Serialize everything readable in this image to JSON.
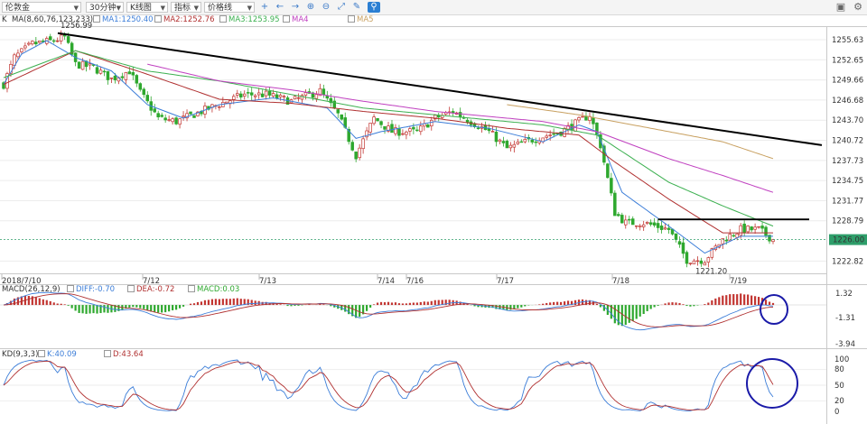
{
  "toolbar": {
    "instrument": "伦敦金",
    "period": "30分钟",
    "chart_type": "K线图",
    "indicator": "指标",
    "price_line": "价格线"
  },
  "legend_main": {
    "prefix": "K",
    "ma_params": "MA(8,60,76,123,233)",
    "ma1": "MA1:1250.40",
    "ma2": "MA2:1252.76",
    "ma3": "MA3:1253.95",
    "ma4": "MA4",
    "ma5": "MA5"
  },
  "legend_macd": {
    "params": "MACD(26,12,9)",
    "diff": "DIFF:-0.70",
    "dea": "DEA:-0.72",
    "macd": "MACD:0.03"
  },
  "legend_kd": {
    "params": "KD(9,3,3)",
    "k": "K:40.09",
    "d": "D:43.64"
  },
  "price_axis": [
    "1255.63",
    "1252.65",
    "1249.66",
    "1246.68",
    "1243.70",
    "1240.72",
    "1237.73",
    "1234.75",
    "1231.77",
    "1228.79",
    "1222.82"
  ],
  "current_price": "1226.00",
  "annotations": {
    "high": "1256.99",
    "low": "1221.20"
  },
  "date_labels": [
    "2018/7/10",
    "7/12",
    "7/13",
    "7/14",
    "7/16",
    "7/17",
    "7/18",
    "7/19"
  ],
  "macd_axis": [
    "1.32",
    "-1.31",
    "-3.94"
  ],
  "kd_axis": [
    "100",
    "80",
    "50",
    "20",
    "0"
  ],
  "colors": {
    "up": "#c23531",
    "down": "#2ea82e",
    "ma1": "#3b7dd8",
    "ma2": "#b03030",
    "ma3": "#3cb050",
    "ma4": "#c040c0",
    "ma5": "#c8a060",
    "trend": "#000000",
    "circle": "#1a1aa8",
    "current": "#2e9e6a"
  },
  "chart_data": {
    "type": "candlestick",
    "ylim_main": [
      1221.0,
      1257.5
    ],
    "ylim_macd": [
      -3.94,
      1.32
    ],
    "ylim_kd": [
      0,
      100
    ],
    "n_bars": 215,
    "close_anchors": [
      [
        0,
        1249
      ],
      [
        3,
        1253
      ],
      [
        8,
        1255
      ],
      [
        14,
        1255.5
      ],
      [
        17,
        1256
      ],
      [
        20,
        1252
      ],
      [
        25,
        1251.5
      ],
      [
        30,
        1249.8
      ],
      [
        35,
        1251
      ],
      [
        38,
        1247.8
      ],
      [
        43,
        1244
      ],
      [
        48,
        1243.5
      ],
      [
        55,
        1245
      ],
      [
        62,
        1246.5
      ],
      [
        67,
        1247.5
      ],
      [
        73,
        1247.5
      ],
      [
        80,
        1246.5
      ],
      [
        88,
        1248
      ],
      [
        93,
        1244.5
      ],
      [
        98,
        1238.5
      ],
      [
        103,
        1244
      ],
      [
        108,
        1242
      ],
      [
        115,
        1242
      ],
      [
        120,
        1244
      ],
      [
        125,
        1245
      ],
      [
        130,
        1243.5
      ],
      [
        135,
        1242
      ],
      [
        140,
        1239.5
      ],
      [
        148,
        1241
      ],
      [
        155,
        1242
      ],
      [
        160,
        1243.5
      ],
      [
        163,
        1244.5
      ],
      [
        166,
        1240
      ],
      [
        170,
        1230
      ],
      [
        173,
        1228.5
      ],
      [
        178,
        1228.5
      ],
      [
        185,
        1227.5
      ],
      [
        190,
        1223
      ],
      [
        195,
        1223
      ],
      [
        200,
        1226
      ],
      [
        205,
        1227.5
      ],
      [
        210,
        1227.5
      ],
      [
        214,
        1226
      ]
    ],
    "ma_anchors": {
      "ma1": [
        [
          0,
          1249
        ],
        [
          5,
          1253.5
        ],
        [
          12,
          1255.5
        ],
        [
          20,
          1253
        ],
        [
          30,
          1251
        ],
        [
          40,
          1246
        ],
        [
          50,
          1244
        ],
        [
          60,
          1246
        ],
        [
          75,
          1247
        ],
        [
          90,
          1245.5
        ],
        [
          98,
          1241
        ],
        [
          105,
          1242
        ],
        [
          120,
          1243.5
        ],
        [
          135,
          1242.5
        ],
        [
          150,
          1240.5
        ],
        [
          160,
          1243
        ],
        [
          165,
          1242
        ],
        [
          172,
          1233
        ],
        [
          185,
          1228
        ],
        [
          195,
          1224
        ],
        [
          205,
          1226.5
        ],
        [
          214,
          1226.5
        ]
      ],
      "ma2": [
        [
          0,
          1249
        ],
        [
          20,
          1254
        ],
        [
          40,
          1250.5
        ],
        [
          60,
          1246.8
        ],
        [
          80,
          1246.2
        ],
        [
          100,
          1245
        ],
        [
          120,
          1244
        ],
        [
          140,
          1242.5
        ],
        [
          160,
          1241.5
        ],
        [
          170,
          1237.5
        ],
        [
          185,
          1232
        ],
        [
          200,
          1227
        ],
        [
          214,
          1227
        ]
      ],
      "ma3": [
        [
          0,
          1250
        ],
        [
          20,
          1254
        ],
        [
          40,
          1251
        ],
        [
          60,
          1249.5
        ],
        [
          80,
          1247.5
        ],
        [
          100,
          1245.5
        ],
        [
          120,
          1244.5
        ],
        [
          150,
          1243
        ],
        [
          165,
          1241.5
        ],
        [
          185,
          1234.5
        ],
        [
          200,
          1231
        ],
        [
          214,
          1228
        ]
      ],
      "ma4": [
        [
          40,
          1252
        ],
        [
          60,
          1249.5
        ],
        [
          80,
          1248.2
        ],
        [
          100,
          1246.5
        ],
        [
          120,
          1245
        ],
        [
          150,
          1243.5
        ],
        [
          165,
          1242
        ],
        [
          185,
          1238
        ],
        [
          200,
          1235.5
        ],
        [
          214,
          1233
        ]
      ],
      "ma5": [
        [
          140,
          1246
        ],
        [
          160,
          1244.5
        ],
        [
          180,
          1242.5
        ],
        [
          200,
          1240.5
        ],
        [
          214,
          1238
        ]
      ]
    },
    "trendline_main": [
      [
        0,
        1256.6
      ],
      [
        214,
        1240
      ]
    ],
    "resistance_line": [
      [
        182,
        1229
      ],
      [
        224,
        1229
      ]
    ],
    "notes": [
      "KD blue circle near last bars",
      "MACD blue circle near last bars"
    ]
  }
}
